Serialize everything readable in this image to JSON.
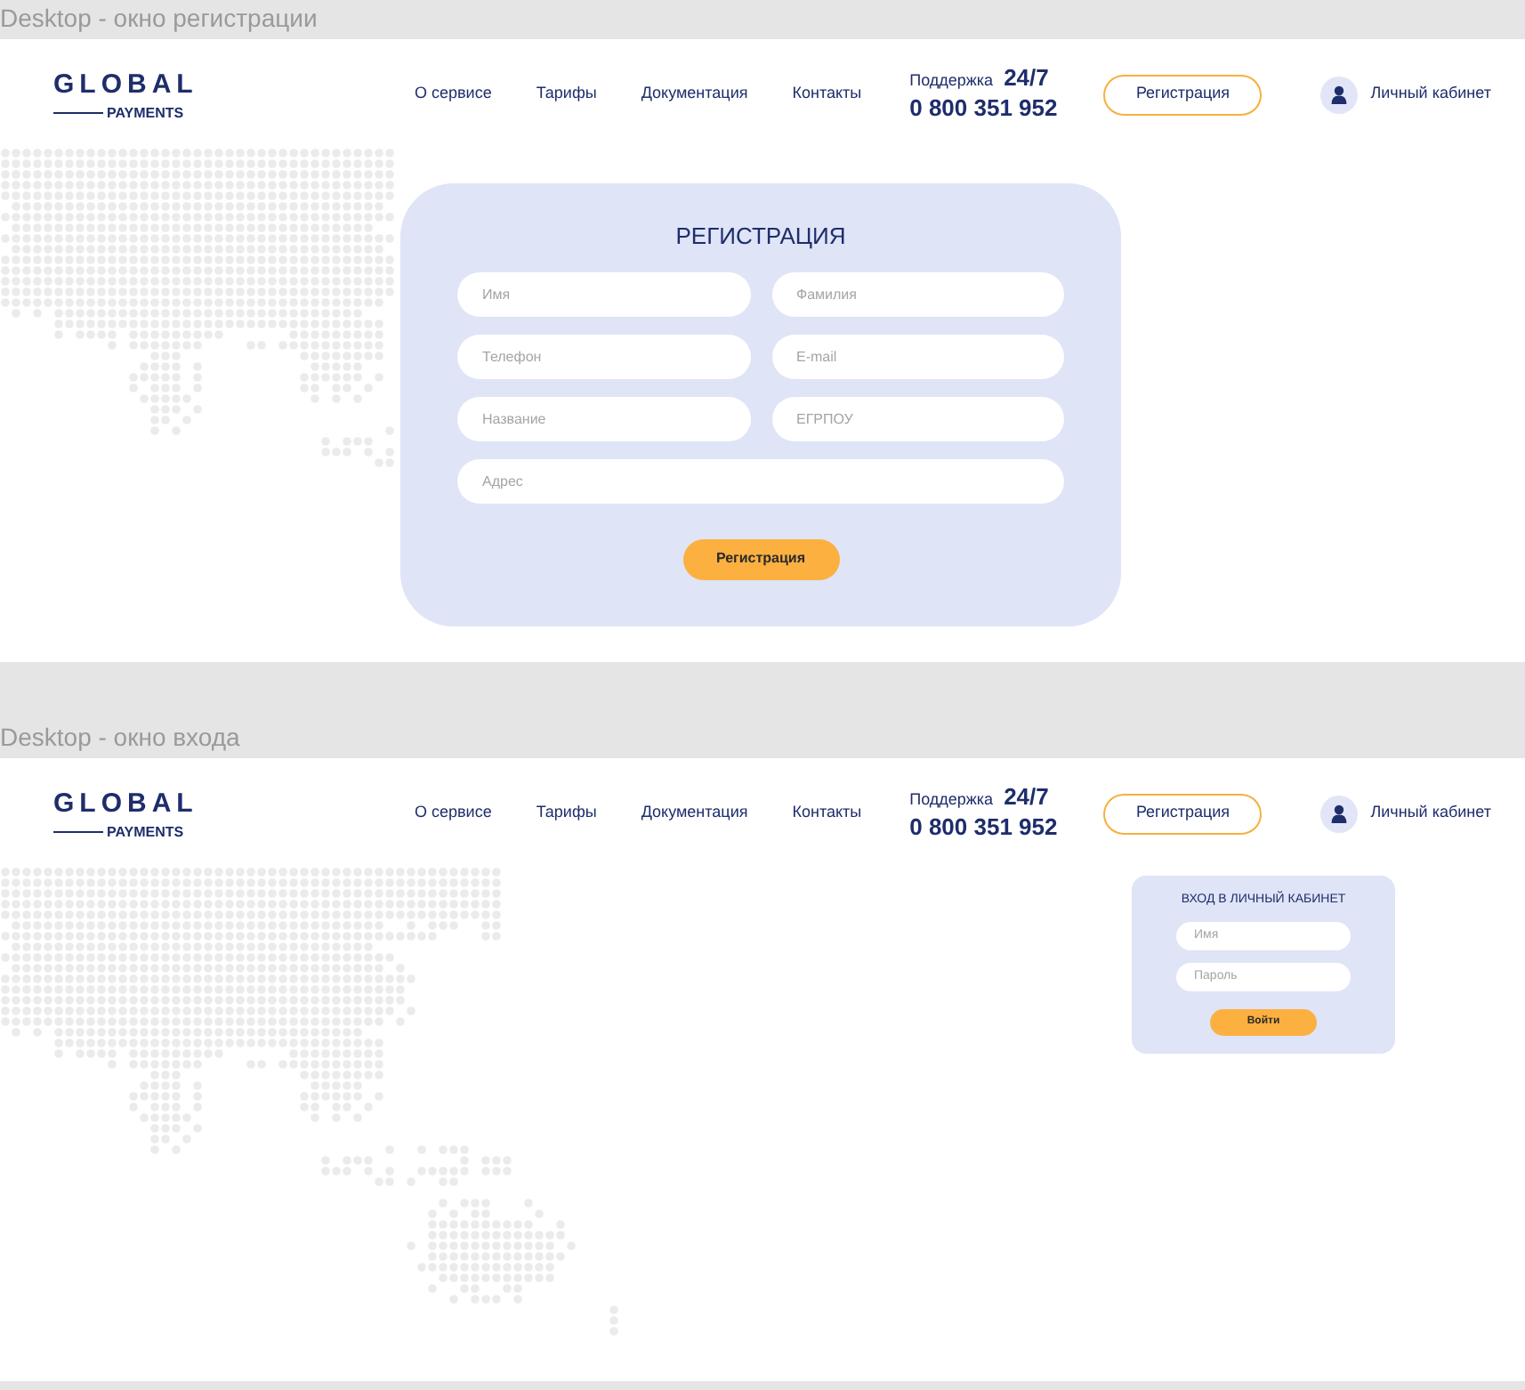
{
  "frames": [
    {
      "label": "Desktop - окно регистрации",
      "kind": "registration",
      "header": {
        "logo_top": "GLOBAL",
        "logo_bottom": "PAYMENTS",
        "nav": [
          "О сервисе",
          "Тарифы",
          "Документация",
          "Контакты"
        ],
        "support_label": "Поддержка",
        "support_hours": "24/7",
        "phone": "0 800 351 952",
        "register_button": "Регистрация",
        "account": "Личный кабинет"
      },
      "form": {
        "title": "РЕГИСТРАЦИЯ",
        "fields": [
          {
            "placeholder": "Имя",
            "wide": false
          },
          {
            "placeholder": "Фамилия",
            "wide": false
          },
          {
            "placeholder": "Телефон",
            "wide": false
          },
          {
            "placeholder": "E-mail",
            "wide": false
          },
          {
            "placeholder": "Название",
            "wide": false
          },
          {
            "placeholder": "ЕГРПОУ",
            "wide": false
          },
          {
            "placeholder": "Адрес",
            "wide": true
          }
        ],
        "button": "Регистрация"
      }
    },
    {
      "label": "Desktop - окно входа",
      "kind": "login",
      "header": {
        "logo_top": "GLOBAL",
        "logo_bottom": "PAYMENTS",
        "nav": [
          "О сервисе",
          "Тарифы",
          "Документация",
          "Контакты"
        ],
        "support_label": "Поддержка",
        "support_hours": "24/7",
        "phone": "0 800 351 952",
        "register_button": "Регистрация",
        "account": "Личный кабинет"
      },
      "form": {
        "title": "ВХОД В ЛИЧНЫЙ КАБИНЕТ",
        "fields": [
          {
            "placeholder": "Имя",
            "wide": false
          },
          {
            "placeholder": "Пароль",
            "wide": false
          }
        ],
        "button": "Войти"
      }
    }
  ]
}
